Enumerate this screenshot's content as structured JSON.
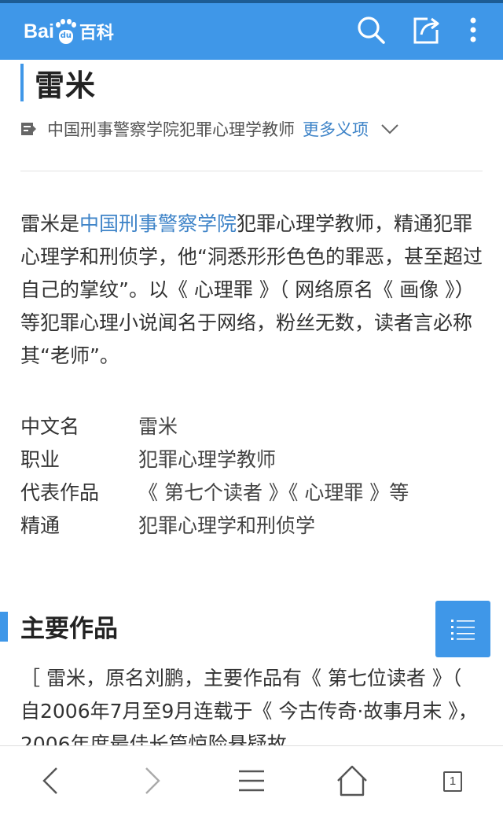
{
  "header": {
    "logo_bai": "Bai",
    "logo_du": "du",
    "logo_baike": "百科",
    "icons": [
      "search-icon",
      "share-icon",
      "more-vertical-icon"
    ]
  },
  "entry": {
    "title": "雷米",
    "ambiguity_text": "中国刑事警察学院犯罪心理学教师",
    "more_meanings": "更多义项"
  },
  "summary": {
    "prefix": "雷米是",
    "link": "中国刑事警察学院",
    "rest": "犯罪心理学教师，精通犯罪心理学和刑侦学，他“洞悉形形色色的罪恶，甚至超过自己的掌纹”。以《 心理罪 》（ 网络原名《 画像 》）等犯罪心理小说闻名于网络，粉丝无数，读者言必称其“老师”。"
  },
  "infobox": [
    {
      "key": "中文名",
      "value": "雷米"
    },
    {
      "key": "职业",
      "value": "犯罪心理学教师"
    },
    {
      "key": "代表作品",
      "value": "《 第七个读者 》《 心理罪 》等"
    },
    {
      "key": "精通",
      "value": "犯罪心理学和刑侦学"
    }
  ],
  "section": {
    "title": "主要作品",
    "body": "［ 雷米，原名刘鹏，主要作品有《 第七位读者 》（ 自2006年7月至9月连载于《 今古传奇·故事月末 》，2006年度最佳长篇惊险悬疑故"
  },
  "bottom_nav": {
    "tab_count": "1"
  },
  "colors": {
    "brand_blue": "#3f97e8",
    "link_blue": "#3f84c8"
  }
}
